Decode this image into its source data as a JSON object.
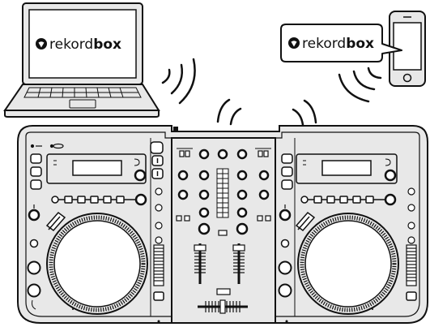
{
  "laptop": {
    "logo_name": "rekordbox-logo",
    "brand_light": "rekord",
    "brand_bold": "box"
  },
  "phone": {
    "logo_name": "rekordbox-logo",
    "brand_light": "rekord",
    "brand_bold": "box"
  },
  "colors": {
    "device_fill": "#e8e8e8",
    "device_stroke": "#111111",
    "screen_fill": "#ffffff"
  }
}
